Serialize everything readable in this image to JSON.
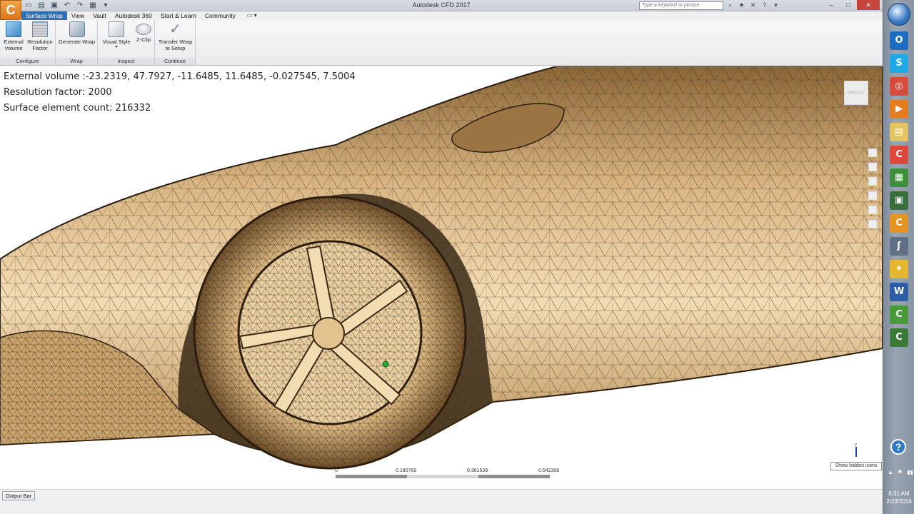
{
  "window": {
    "title": "Autodesk CFD 2017",
    "app_letter": "C",
    "search_placeholder": "Type a keyword or phrase",
    "min_glyph": "–",
    "max_glyph": "□",
    "close_glyph": "✕"
  },
  "ribbon": {
    "tabs": [
      {
        "label": "Surface Wrap",
        "active": true
      },
      {
        "label": "View"
      },
      {
        "label": "Vault"
      },
      {
        "label": "Autodesk 360"
      },
      {
        "label": "Start & Learn"
      },
      {
        "label": "Community"
      }
    ],
    "tab_extra": "▭ ▾",
    "groups": [
      {
        "label": "Configure",
        "buttons": [
          "External\nVolume",
          "Resolution\nFactor"
        ]
      },
      {
        "label": "Wrap",
        "buttons": [
          "Generate Wrap"
        ]
      },
      {
        "label": "Inspect",
        "buttons": [
          "Visual Style",
          "Z-Clip"
        ]
      },
      {
        "label": "Continue",
        "buttons": [
          "Transfer Wrap\nto Setup"
        ]
      }
    ],
    "visual_style_arrow": "▾"
  },
  "viewport": {
    "info": [
      "External volume :-23.2319, 47.7927, -11.6485, 11.6485, -0.027545, 7.5004",
      "Resolution factor: 2000",
      "Surface element count: 216332"
    ],
    "viewcube_label": "FRONT",
    "scale": {
      "ticks": [
        "0",
        "0.180769",
        "0.361539",
        "0.542308"
      ]
    },
    "triad_label": "Z"
  },
  "statusbar": {
    "output_bar": "Output Bar"
  },
  "taskbar": {
    "icons": [
      {
        "name": "outlook-icon",
        "glyph": "O",
        "color": "#1c6dc1"
      },
      {
        "name": "skype-icon",
        "glyph": "S",
        "color": "#1ea8e6"
      },
      {
        "name": "chrome-icon",
        "glyph": "◎",
        "color": "#d94a3a"
      },
      {
        "name": "media-player-icon",
        "glyph": "▶",
        "color": "#e77c1e"
      },
      {
        "name": "file-explorer-icon",
        "glyph": "▤",
        "color": "#e4c462"
      },
      {
        "name": "cfd-red-icon",
        "glyph": "C",
        "color": "#e0473c"
      },
      {
        "name": "spreadsheet-icon",
        "glyph": "▦",
        "color": "#3e8e3b"
      },
      {
        "name": "monitor-icon",
        "glyph": "▣",
        "color": "#3b6e3e"
      },
      {
        "name": "autodesk-orange-icon",
        "glyph": "C",
        "color": "#e69522"
      },
      {
        "name": "script-icon",
        "glyph": "ʃ",
        "color": "#5f6f84"
      },
      {
        "name": "autodesk-folder-icon",
        "glyph": "✦",
        "color": "#e5b72e"
      },
      {
        "name": "word-icon",
        "glyph": "W",
        "color": "#2f5ca8"
      },
      {
        "name": "camtasia-green-icon",
        "glyph": "C",
        "color": "#4a9a3a"
      },
      {
        "name": "camtasia-dark-icon",
        "glyph": "C",
        "color": "#3c7a3a"
      }
    ],
    "help": "?",
    "tray_tooltip": "Show hidden icons",
    "tray": [
      "▲",
      "⚑",
      "▮▮"
    ],
    "time": "8:31 AM",
    "date": "2/23/2016"
  }
}
